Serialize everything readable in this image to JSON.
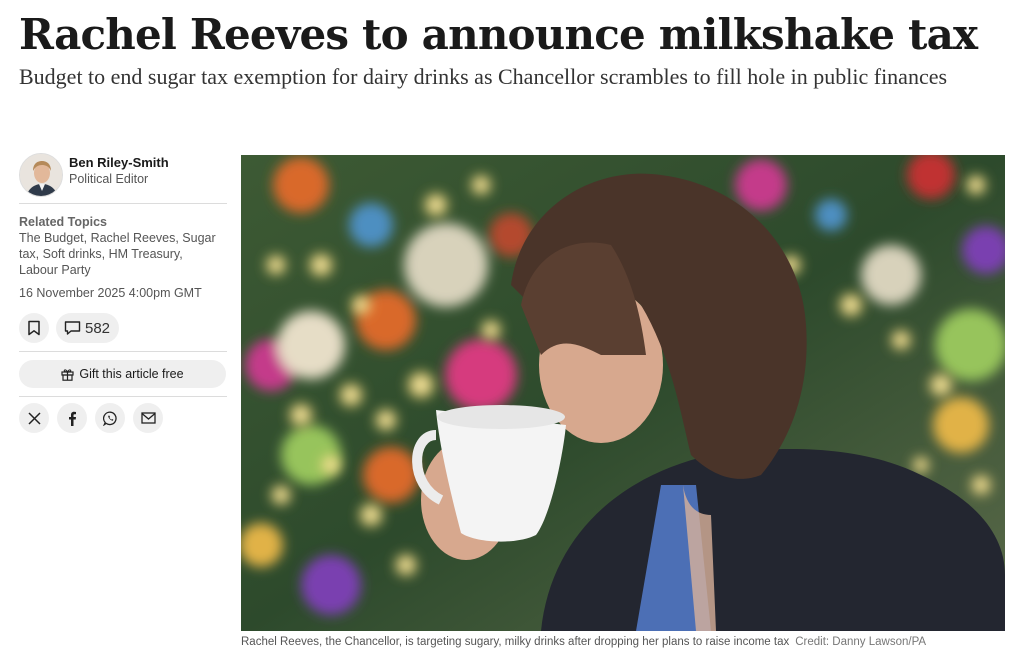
{
  "article": {
    "headline": "Rachel Reeves to announce milkshake tax",
    "standfirst": "Budget to end sugar tax exemption for dairy drinks as Chancellor scrambles to fill hole in public finances"
  },
  "author": {
    "name": "Ben Riley-Smith",
    "role": "Political Editor"
  },
  "topics": {
    "title": "Related Topics",
    "list": "The Budget, Rachel Reeves, Sugar tax, Soft drinks, HM Treasury, Labour Party"
  },
  "published": "16 November 2025 4:00pm GMT",
  "actions": {
    "bookmark_icon": "bookmark-icon",
    "comment_icon": "comment-icon",
    "comment_count": "582",
    "gift_label": "Gift this article free",
    "gift_icon": "gift-icon"
  },
  "social": [
    "x-icon",
    "facebook-icon",
    "whatsapp-icon",
    "email-icon"
  ],
  "image": {
    "caption": "Rachel Reeves, the Chancellor, is targeting sugary, milky drinks after dropping her plans to raise income tax",
    "credit": "Credit: Danny Lawson/PA"
  },
  "colors": {
    "text": "#1a1a1a",
    "muted": "#555555",
    "button_bg": "#efefef"
  }
}
